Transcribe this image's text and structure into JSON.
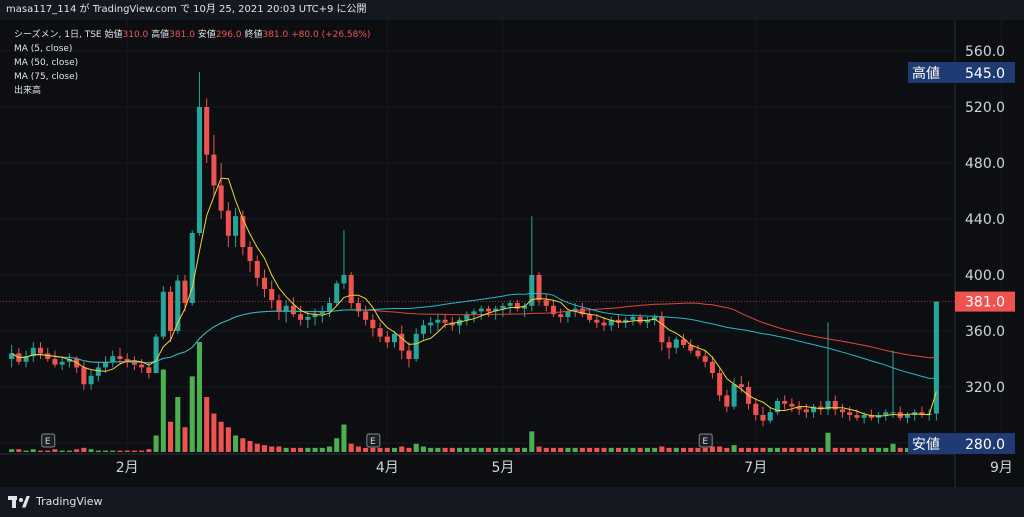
{
  "header": {
    "publish_info": "masa117_114 が TradingView.com で 10月 25, 2021 20:03 UTC+9 に公開"
  },
  "legend": {
    "symbol": "シーズメン, 1日, TSE",
    "open_label": "始値",
    "open": "310.0",
    "high_label": "高値",
    "high": "381.0",
    "low_label": "安値",
    "low": "296.0",
    "close_label": "終値",
    "close": "381.0",
    "change": "+80.0 (+26.58%)",
    "ma5": "MA (5, close)",
    "ma50": "MA (50, close)",
    "ma75": "MA (75, close)",
    "volume": "出来高"
  },
  "colors": {
    "up": "#26a69a",
    "down": "#ef5350",
    "ma5": "#f2d33a",
    "ma50": "#26b8c6",
    "ma75": "#e0473f",
    "vol_up": "#4caf50",
    "vol_down": "#ef5350",
    "price_tag_bg": "#ef5350",
    "hl_tag_bg": "#1f3b73"
  },
  "footer": {
    "brand": "TradingView"
  },
  "chart_data": {
    "type": "candlestick",
    "y_ticks": [
      "560.0",
      "520.0",
      "480.0",
      "440.0",
      "400.0",
      "360.0",
      "320.0",
      "280.0"
    ],
    "ylim": [
      275,
      575
    ],
    "x_ticks": [
      "2月",
      "4月",
      "5月",
      "7月",
      "9月"
    ],
    "last_price": "381.0",
    "high_tag": {
      "label": "高値",
      "value": "545.0"
    },
    "low_tag": {
      "label": "安値",
      "value": "280.0"
    },
    "earnings_marker": "E",
    "ohlc": [
      [
        340,
        350,
        334,
        344
      ],
      [
        344,
        348,
        336,
        338
      ],
      [
        338,
        346,
        334,
        342
      ],
      [
        342,
        352,
        338,
        348
      ],
      [
        348,
        352,
        340,
        344
      ],
      [
        344,
        348,
        338,
        340
      ],
      [
        340,
        346,
        334,
        336
      ],
      [
        336,
        342,
        332,
        338
      ],
      [
        338,
        344,
        334,
        340
      ],
      [
        340,
        342,
        330,
        334
      ],
      [
        334,
        338,
        318,
        322
      ],
      [
        322,
        332,
        318,
        328
      ],
      [
        328,
        338,
        324,
        334
      ],
      [
        334,
        342,
        330,
        338
      ],
      [
        338,
        346,
        334,
        342
      ],
      [
        342,
        348,
        336,
        340
      ],
      [
        340,
        344,
        334,
        338
      ],
      [
        338,
        342,
        332,
        336
      ],
      [
        336,
        340,
        330,
        334
      ],
      [
        334,
        338,
        326,
        330
      ],
      [
        330,
        358,
        330,
        356
      ],
      [
        356,
        392,
        354,
        388
      ],
      [
        388,
        392,
        352,
        360
      ],
      [
        360,
        400,
        358,
        396
      ],
      [
        396,
        400,
        374,
        380
      ],
      [
        380,
        432,
        378,
        430
      ],
      [
        430,
        545,
        428,
        520
      ],
      [
        520,
        526,
        480,
        486
      ],
      [
        486,
        500,
        456,
        464
      ],
      [
        464,
        480,
        440,
        446
      ],
      [
        446,
        452,
        420,
        428
      ],
      [
        428,
        448,
        420,
        442
      ],
      [
        442,
        446,
        414,
        420
      ],
      [
        420,
        424,
        402,
        410
      ],
      [
        410,
        414,
        392,
        398
      ],
      [
        398,
        404,
        384,
        390
      ],
      [
        390,
        396,
        376,
        382
      ],
      [
        382,
        386,
        368,
        374
      ],
      [
        374,
        382,
        366,
        378
      ],
      [
        378,
        384,
        370,
        372
      ],
      [
        372,
        378,
        364,
        368
      ],
      [
        368,
        374,
        362,
        370
      ],
      [
        370,
        376,
        364,
        372
      ],
      [
        372,
        378,
        366,
        374
      ],
      [
        374,
        384,
        370,
        380
      ],
      [
        380,
        396,
        378,
        394
      ],
      [
        394,
        432,
        390,
        400
      ],
      [
        400,
        402,
        376,
        380
      ],
      [
        380,
        384,
        370,
        374
      ],
      [
        374,
        378,
        364,
        368
      ],
      [
        368,
        372,
        356,
        362
      ],
      [
        362,
        366,
        352,
        356
      ],
      [
        356,
        360,
        348,
        352
      ],
      [
        352,
        360,
        348,
        358
      ],
      [
        358,
        364,
        340,
        346
      ],
      [
        346,
        352,
        334,
        340
      ],
      [
        340,
        362,
        338,
        358
      ],
      [
        358,
        368,
        354,
        364
      ],
      [
        364,
        370,
        358,
        366
      ],
      [
        366,
        372,
        360,
        368
      ],
      [
        368,
        372,
        362,
        366
      ],
      [
        366,
        370,
        360,
        364
      ],
      [
        364,
        370,
        358,
        368
      ],
      [
        368,
        374,
        364,
        372
      ],
      [
        372,
        376,
        366,
        374
      ],
      [
        374,
        378,
        368,
        376
      ],
      [
        376,
        378,
        370,
        374
      ],
      [
        374,
        378,
        368,
        376
      ],
      [
        376,
        380,
        370,
        378
      ],
      [
        378,
        382,
        372,
        380
      ],
      [
        380,
        382,
        374,
        376
      ],
      [
        376,
        380,
        370,
        378
      ],
      [
        378,
        442,
        374,
        400
      ],
      [
        400,
        402,
        378,
        382
      ],
      [
        382,
        386,
        374,
        378
      ],
      [
        378,
        382,
        370,
        372
      ],
      [
        372,
        376,
        366,
        370
      ],
      [
        370,
        376,
        366,
        374
      ],
      [
        374,
        380,
        370,
        376
      ],
      [
        376,
        380,
        370,
        372
      ],
      [
        372,
        376,
        366,
        368
      ],
      [
        368,
        372,
        362,
        366
      ],
      [
        366,
        370,
        360,
        364
      ],
      [
        364,
        370,
        360,
        368
      ],
      [
        368,
        372,
        362,
        366
      ],
      [
        366,
        370,
        362,
        368
      ],
      [
        368,
        372,
        364,
        370
      ],
      [
        370,
        372,
        364,
        366
      ],
      [
        366,
        370,
        362,
        368
      ],
      [
        368,
        372,
        364,
        370
      ],
      [
        370,
        374,
        346,
        352
      ],
      [
        352,
        356,
        340,
        348
      ],
      [
        348,
        356,
        344,
        354
      ],
      [
        354,
        358,
        348,
        350
      ],
      [
        350,
        354,
        344,
        346
      ],
      [
        346,
        350,
        340,
        342
      ],
      [
        342,
        346,
        334,
        338
      ],
      [
        338,
        342,
        326,
        330
      ],
      [
        330,
        334,
        310,
        314
      ],
      [
        314,
        318,
        302,
        306
      ],
      [
        306,
        326,
        304,
        322
      ],
      [
        322,
        328,
        316,
        320
      ],
      [
        320,
        324,
        304,
        308
      ],
      [
        308,
        312,
        296,
        300
      ],
      [
        300,
        306,
        292,
        296
      ],
      [
        296,
        306,
        294,
        302
      ],
      [
        302,
        312,
        300,
        310
      ],
      [
        310,
        314,
        304,
        308
      ],
      [
        308,
        312,
        302,
        306
      ],
      [
        306,
        310,
        300,
        304
      ],
      [
        304,
        308,
        298,
        302
      ],
      [
        302,
        308,
        298,
        306
      ],
      [
        306,
        310,
        300,
        304
      ],
      [
        304,
        366,
        300,
        310
      ],
      [
        310,
        314,
        300,
        304
      ],
      [
        304,
        308,
        298,
        302
      ],
      [
        302,
        306,
        296,
        300
      ],
      [
        300,
        304,
        296,
        298
      ],
      [
        298,
        302,
        294,
        300
      ],
      [
        300,
        304,
        296,
        298
      ],
      [
        298,
        302,
        294,
        300
      ],
      [
        300,
        304,
        296,
        302
      ],
      [
        302,
        346,
        298,
        302
      ],
      [
        302,
        306,
        296,
        298
      ],
      [
        298,
        302,
        294,
        300
      ],
      [
        300,
        304,
        296,
        302
      ],
      [
        302,
        306,
        298,
        300
      ],
      [
        300,
        304,
        296,
        301
      ],
      [
        301,
        381,
        296,
        381
      ]
    ],
    "volume": [
      2,
      2,
      1,
      2,
      1,
      1,
      2,
      1,
      1,
      2,
      3,
      2,
      1,
      1,
      1,
      1,
      1,
      1,
      1,
      2,
      12,
      60,
      22,
      40,
      18,
      55,
      80,
      40,
      28,
      22,
      18,
      12,
      10,
      8,
      6,
      5,
      4,
      4,
      3,
      3,
      3,
      3,
      3,
      3,
      4,
      10,
      20,
      6,
      4,
      3,
      3,
      3,
      3,
      3,
      4,
      3,
      6,
      4,
      3,
      3,
      3,
      3,
      3,
      3,
      3,
      3,
      3,
      3,
      3,
      3,
      3,
      3,
      15,
      4,
      3,
      3,
      3,
      3,
      3,
      3,
      3,
      3,
      3,
      3,
      3,
      3,
      3,
      3,
      3,
      3,
      4,
      3,
      3,
      3,
      3,
      3,
      3,
      4,
      4,
      3,
      5,
      3,
      3,
      3,
      3,
      3,
      3,
      3,
      3,
      3,
      3,
      3,
      3,
      14,
      3,
      3,
      3,
      3,
      3,
      3,
      3,
      3,
      6,
      3,
      3,
      3,
      3,
      3,
      3
    ]
  }
}
